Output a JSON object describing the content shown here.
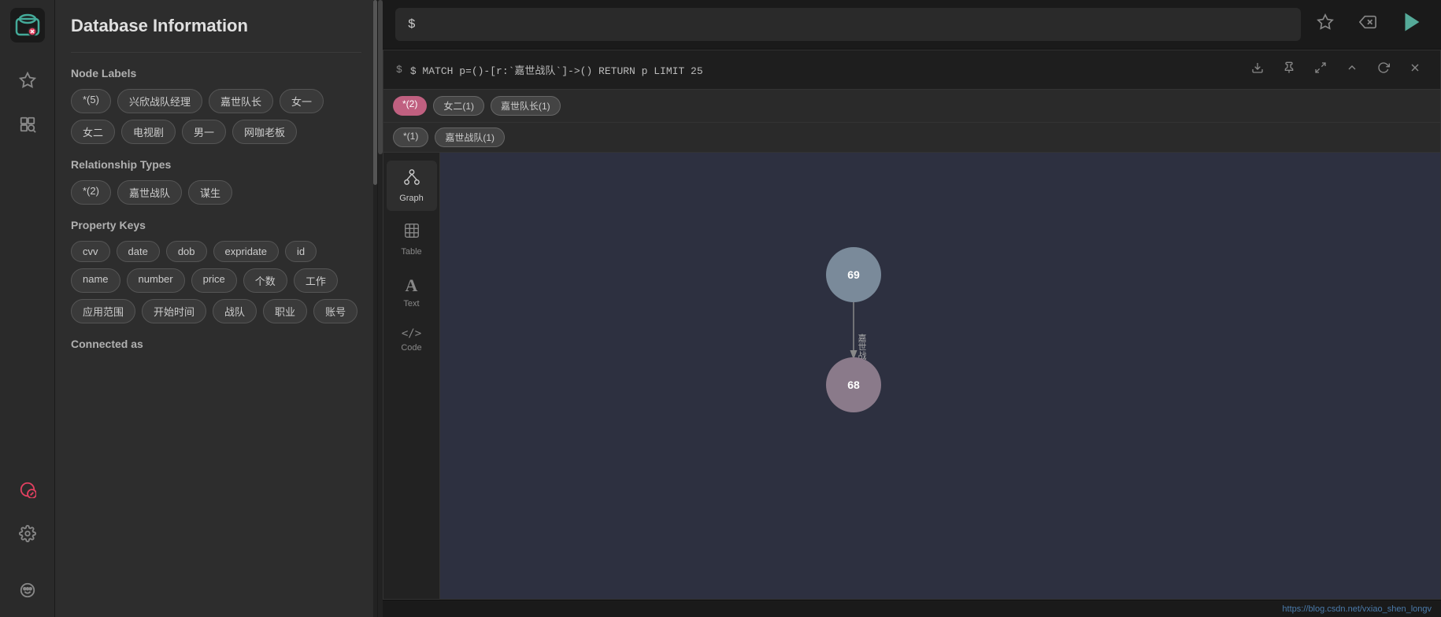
{
  "app": {
    "title": "Database Information"
  },
  "sidebar": {
    "title": "Database Information",
    "sections": {
      "nodeLabels": {
        "label": "Node Labels",
        "tags": [
          "*(5)",
          "兴欣战队经理",
          "嘉世队长",
          "女一",
          "女二",
          "电视剧",
          "男一",
          "网咖老板"
        ]
      },
      "relationshipTypes": {
        "label": "Relationship Types",
        "tags": [
          "*(2)",
          "嘉世战队",
          "谋生"
        ]
      },
      "propertyKeys": {
        "label": "Property Keys",
        "tags": [
          "cvv",
          "date",
          "dob",
          "expridate",
          "id",
          "name",
          "number",
          "price",
          "个数",
          "工作",
          "应用范围",
          "开始时间",
          "战队",
          "职业",
          "账号"
        ]
      },
      "connectedAs": {
        "label": "Connected as"
      }
    }
  },
  "queryBar": {
    "placeholder": "$",
    "input": "$"
  },
  "queryActions": {
    "star": "★",
    "eraser": "◻",
    "run": "▷"
  },
  "resultHeader": {
    "query": "$ MATCH p=()-[r:`嘉世战队`]->() RETURN p LIMIT 25",
    "actions": {
      "download": "⬇",
      "pin": "⊕",
      "expand": "⤢",
      "up": "∧",
      "refresh": "↻",
      "close": "✕"
    }
  },
  "filterRow1": {
    "badges": [
      {
        "label": "*(2)",
        "type": "pink"
      },
      {
        "label": "女二(1)",
        "type": "gray"
      },
      {
        "label": "嘉世队长(1)",
        "type": "gray"
      }
    ]
  },
  "filterRow2": {
    "badges": [
      {
        "label": "*(1)",
        "type": "gray"
      },
      {
        "label": "嘉世战队(1)",
        "type": "gray"
      }
    ]
  },
  "viewTabs": [
    {
      "id": "graph",
      "label": "Graph",
      "icon": "⬡"
    },
    {
      "id": "table",
      "label": "Table",
      "icon": "⊞"
    },
    {
      "id": "text",
      "label": "Text",
      "icon": "A"
    },
    {
      "id": "code",
      "label": "Code",
      "icon": "</>"
    }
  ],
  "graph": {
    "nodes": [
      {
        "id": "69",
        "label": "69"
      },
      {
        "id": "68",
        "label": "68"
      }
    ],
    "edgeLabel": "嘉世战队"
  },
  "statusBar": {
    "url": "https://blog.csdn.net/vxiao_shen_longv"
  }
}
